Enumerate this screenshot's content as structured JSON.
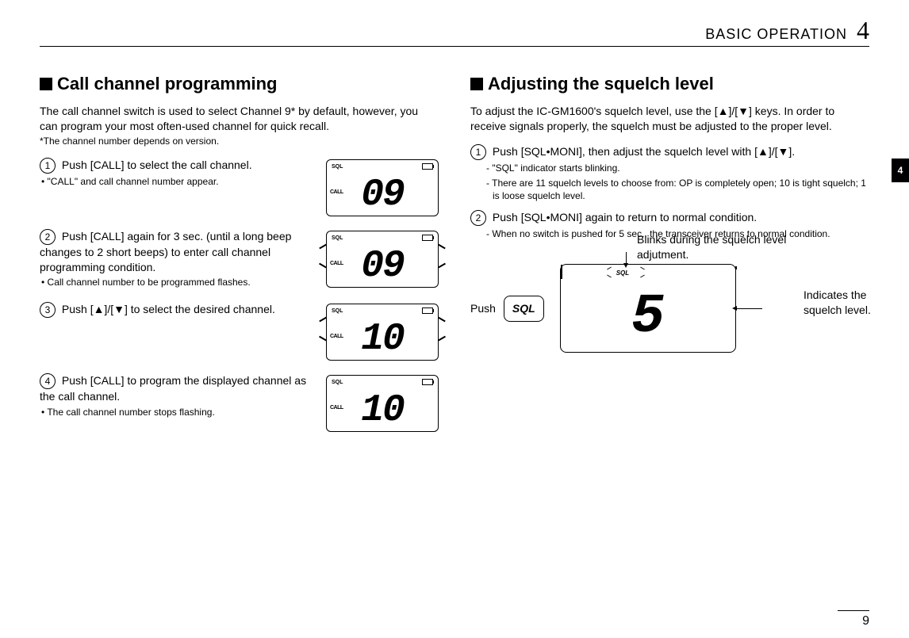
{
  "header": {
    "section": "BASIC OPERATION",
    "chapter_num": "4"
  },
  "side_tab": "4",
  "left": {
    "heading": "Call channel programming",
    "intro": "The call channel switch is used to select Channel 9* by default, however, you can program your most often-used channel for quick recall.",
    "footnote": "*The channel number depends on version.",
    "steps": [
      {
        "num": "1",
        "text": "Push [CALL] to select the call channel.",
        "sub": "• \"CALL\" and call channel number appear.",
        "lcd_digits": "09",
        "flash": false
      },
      {
        "num": "2",
        "text": "Push [CALL] again for 3 sec. (until a long beep changes to 2 short beeps) to enter call channel programming condition.",
        "sub": "• Call channel number to be programmed flashes.",
        "lcd_digits": "09",
        "flash": true
      },
      {
        "num": "3",
        "text": "Push [▲]/[▼] to select the desired channel.",
        "sub": "",
        "lcd_digits": "10",
        "flash": true
      },
      {
        "num": "4",
        "text": "Push [CALL] to program the displayed channel as the call channel.",
        "sub": "• The call channel number stops flashing.",
        "lcd_digits": "10",
        "flash": false
      }
    ],
    "lcd_labels": {
      "sql": "SQL",
      "call": "CALL"
    }
  },
  "right": {
    "heading": "Adjusting the squelch level",
    "intro": "To adjust the IC-GM1600's squelch level, use the [▲]/[▼] keys. In order to receive signals properly, the squelch must be adjusted to the proper level.",
    "steps": [
      {
        "num": "1",
        "text": "Push [SQL•MONI], then adjust the squelch level with [▲]/[▼].",
        "subs": [
          "- \"SQL\" indicator starts blinking.",
          "- There are 11 squelch levels to choose from: OP is completely open; 10 is tight squelch; 1 is loose squelch level."
        ]
      },
      {
        "num": "2",
        "text": "Push [SQL•MONI] again to return to normal condition.",
        "subs": [
          "- When no switch is pushed for 5 sec., the transceiver returns to normal condition."
        ]
      }
    ],
    "diagram": {
      "push_label": "Push",
      "key_label": "SQL",
      "blinks_label": "Blinks during the squelch level adjutment.",
      "indicates_label": "Indicates the squelch level.",
      "lcd_digit": "5",
      "lcd_sql": "SQL"
    }
  },
  "page_number": "9"
}
